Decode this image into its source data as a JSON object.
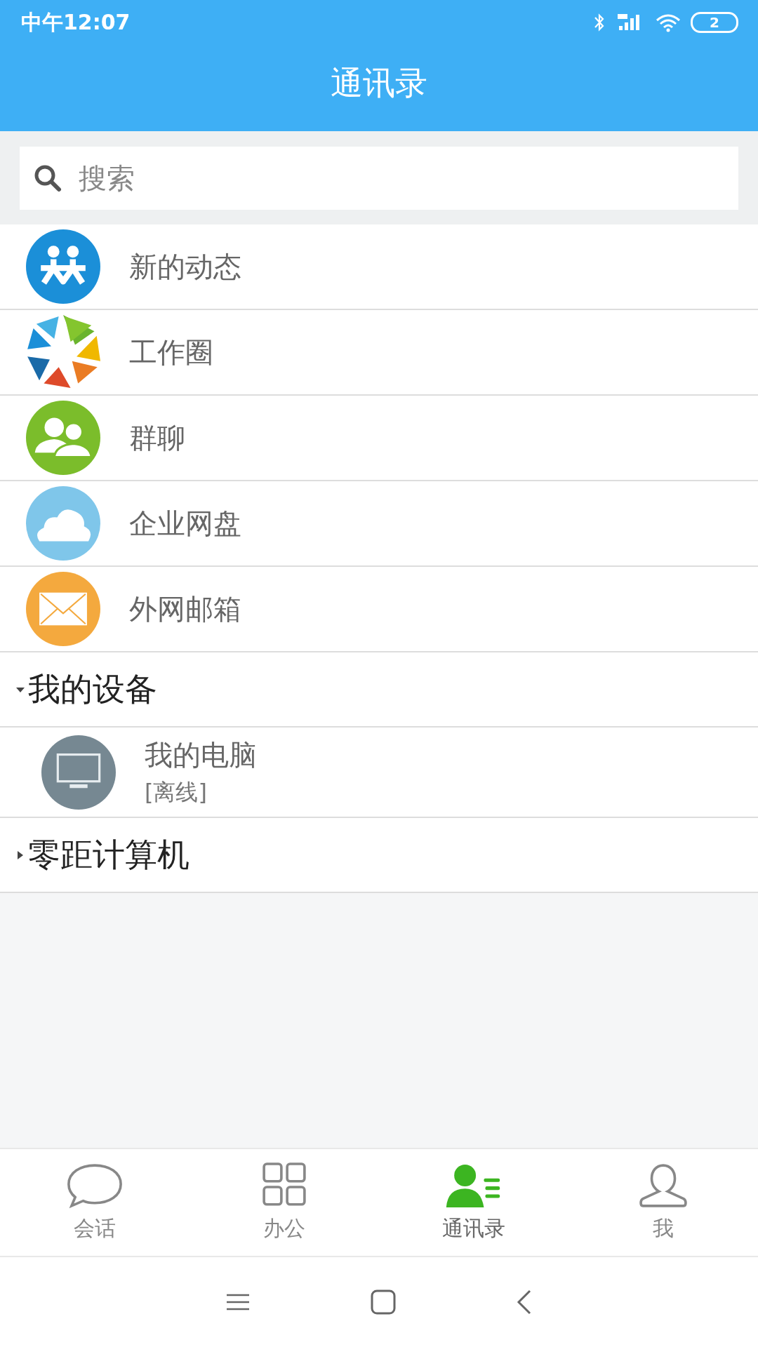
{
  "status_bar": {
    "time": "中午12:07",
    "battery": "2"
  },
  "header": {
    "title": "通讯录"
  },
  "search": {
    "placeholder": "搜索"
  },
  "entries": [
    {
      "label": "新的动态",
      "kind": "people"
    },
    {
      "label": "工作圈",
      "kind": "aperture"
    },
    {
      "label": "群聊",
      "kind": "group"
    },
    {
      "label": "企业网盘",
      "kind": "cloud"
    },
    {
      "label": "外网邮箱",
      "kind": "mail"
    }
  ],
  "groups": [
    {
      "name": "我的设备",
      "expanded": true,
      "children": [
        {
          "name": "我的电脑",
          "status": "[离线]"
        }
      ]
    },
    {
      "name": "零距计算机",
      "expanded": false
    }
  ],
  "tabs": [
    {
      "label": "会话",
      "kind": "chat",
      "selected": false
    },
    {
      "label": "办公",
      "kind": "grid",
      "selected": false
    },
    {
      "label": "通讯录",
      "kind": "contacts",
      "selected": true
    },
    {
      "label": "我",
      "kind": "person",
      "selected": false
    }
  ]
}
